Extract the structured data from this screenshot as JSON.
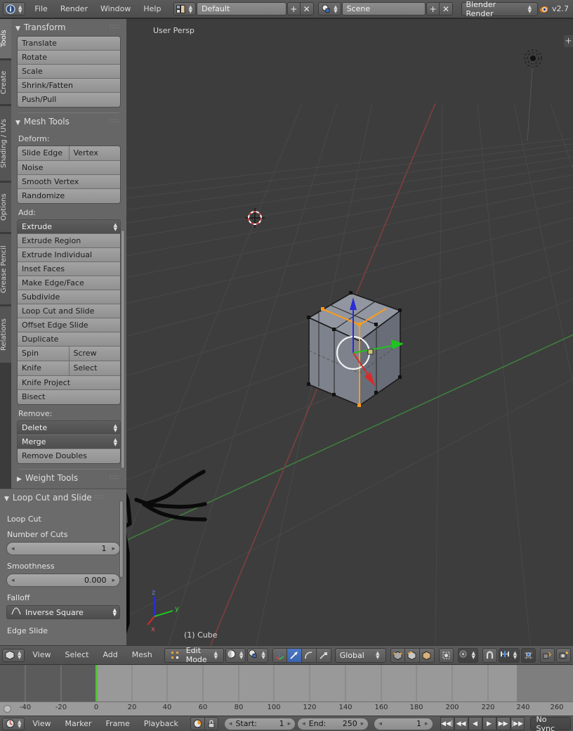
{
  "app": {
    "version": "v2.7",
    "blender_icon": "blender-logo-icon"
  },
  "topbar": {
    "editor_icon": "info-editor-icon",
    "menus": [
      "File",
      "Render",
      "Window",
      "Help"
    ],
    "screen": {
      "icon": "screen-layout-icon",
      "value": "Default",
      "add_label": "+",
      "remove_label": "✕"
    },
    "scene": {
      "icon": "scene-icon",
      "value": "Scene",
      "add_label": "+",
      "remove_label": "✕"
    },
    "engine": {
      "value": "Blender Render"
    }
  },
  "tabstrip": {
    "items": [
      {
        "label": "Tools",
        "active": true
      },
      {
        "label": "Create",
        "active": false
      },
      {
        "label": "Shading / UVs",
        "active": false
      },
      {
        "label": "Options",
        "active": false
      },
      {
        "label": "Grease Pencil",
        "active": false
      },
      {
        "label": "Relations",
        "active": false
      }
    ]
  },
  "tools_panel": {
    "transform": {
      "title": "Transform",
      "buttons": [
        "Translate",
        "Rotate",
        "Scale",
        "Shrink/Fatten",
        "Push/Pull"
      ]
    },
    "mesh_tools": {
      "title": "Mesh Tools",
      "deform_label": "Deform:",
      "deform_rows": [
        [
          "Slide Edge",
          "Vertex"
        ],
        [
          "Noise"
        ],
        [
          "Smooth Vertex"
        ],
        [
          "Randomize"
        ]
      ],
      "add_label": "Add:",
      "add_menu": "Extrude",
      "add_rows": [
        [
          "Extrude Region"
        ],
        [
          "Extrude Individual"
        ],
        [
          "Inset Faces"
        ],
        [
          "Make Edge/Face"
        ],
        [
          "Subdivide"
        ],
        [
          "Loop Cut and Slide"
        ],
        [
          "Offset Edge Slide"
        ],
        [
          "Duplicate"
        ],
        [
          "Spin",
          "Screw"
        ],
        [
          "Knife",
          "Select"
        ],
        [
          "Knife Project"
        ],
        [
          "Bisect"
        ]
      ],
      "remove_label": "Remove:",
      "remove_menus": [
        "Delete",
        "Merge"
      ],
      "remove_rows": [
        [
          "Remove Doubles"
        ]
      ]
    },
    "weight_tools": {
      "title": "Weight Tools",
      "collapsed": true
    }
  },
  "operator_panel": {
    "title": "Loop Cut and Slide",
    "section_loop_cut": "Loop Cut",
    "number_of_cuts": {
      "label": "Number of Cuts",
      "value": "1"
    },
    "smoothness": {
      "label": "Smoothness",
      "value": "0.000"
    },
    "falloff": {
      "label": "Falloff",
      "value": "Inverse Square",
      "icon": "falloff-curve-icon"
    },
    "section_edge_slide": "Edge Slide"
  },
  "viewport": {
    "view_label": "User Persp",
    "object_label": "(1) Cube",
    "axis_gizmo": {
      "x": "x",
      "y": "y",
      "z": "z"
    },
    "colors": {
      "background": "#3d3d3d",
      "grid": "#4a4a4a",
      "axis_x": "#8a3a3a",
      "axis_y": "#3a7a3a",
      "selected_edge": "#ff9b1a",
      "manipulator_x": "#d72b2b",
      "manipulator_y": "#1fc41f",
      "manipulator_z": "#2b2bd7"
    },
    "annotation": {
      "type": "hand-drawn-ink",
      "color": "#0a0a0a"
    }
  },
  "viewport_header": {
    "editor_icon": "mesh-editor-icon",
    "menus": [
      "View",
      "Select",
      "Add",
      "Mesh"
    ],
    "mode": {
      "value": "Edit Mode",
      "icon": "edit-mode-icon"
    },
    "shading": {
      "icon": "shading-solid-icon"
    },
    "draw_type": {
      "icon": "material-preview-icon"
    },
    "manipulator": {
      "enabled": true,
      "icons": [
        "translate-manipulator-icon",
        "rotate-manipulator-icon",
        "scale-manipulator-icon"
      ]
    },
    "orientation": {
      "value": "Global"
    },
    "select_modes": [
      "vertex-select-icon",
      "edge-select-icon",
      "face-select-icon"
    ],
    "occlude": {
      "icon": "limit-selection-visible-icon"
    },
    "pivot": {
      "icon": "pivot-median-point-icon"
    },
    "snap": {
      "icon": "magnet-icon"
    },
    "snap_target": {
      "icon": "snap-increment-icon"
    },
    "proportional": {
      "icon": "proportional-edit-icon"
    },
    "render_icons": [
      "render-local-view-icon",
      "render-preview-icon"
    ]
  },
  "timeline": {
    "ticks": [
      "-40",
      "-20",
      "0",
      "20",
      "40",
      "60",
      "80",
      "100",
      "120",
      "140",
      "160",
      "180",
      "200",
      "220",
      "240",
      "260"
    ],
    "playhead_frame": "0",
    "playhead_color": "#52c238",
    "header": {
      "editor_icon": "timeline-editor-icon",
      "menus": [
        "View",
        "Marker",
        "Frame",
        "Playback"
      ],
      "auto_key": {
        "icon": "record-icon"
      },
      "lock": {
        "icon": "lock-icon"
      },
      "start": {
        "label": "Start:",
        "value": "1"
      },
      "end": {
        "label": "End:",
        "value": "250"
      },
      "current_frame": {
        "value": "1"
      },
      "transport": [
        "jump-to-start-icon",
        "step-back-icon",
        "play-reverse-icon",
        "play-icon",
        "step-forward-icon",
        "jump-to-end-icon"
      ],
      "sync": {
        "value": "No Sync"
      }
    }
  }
}
